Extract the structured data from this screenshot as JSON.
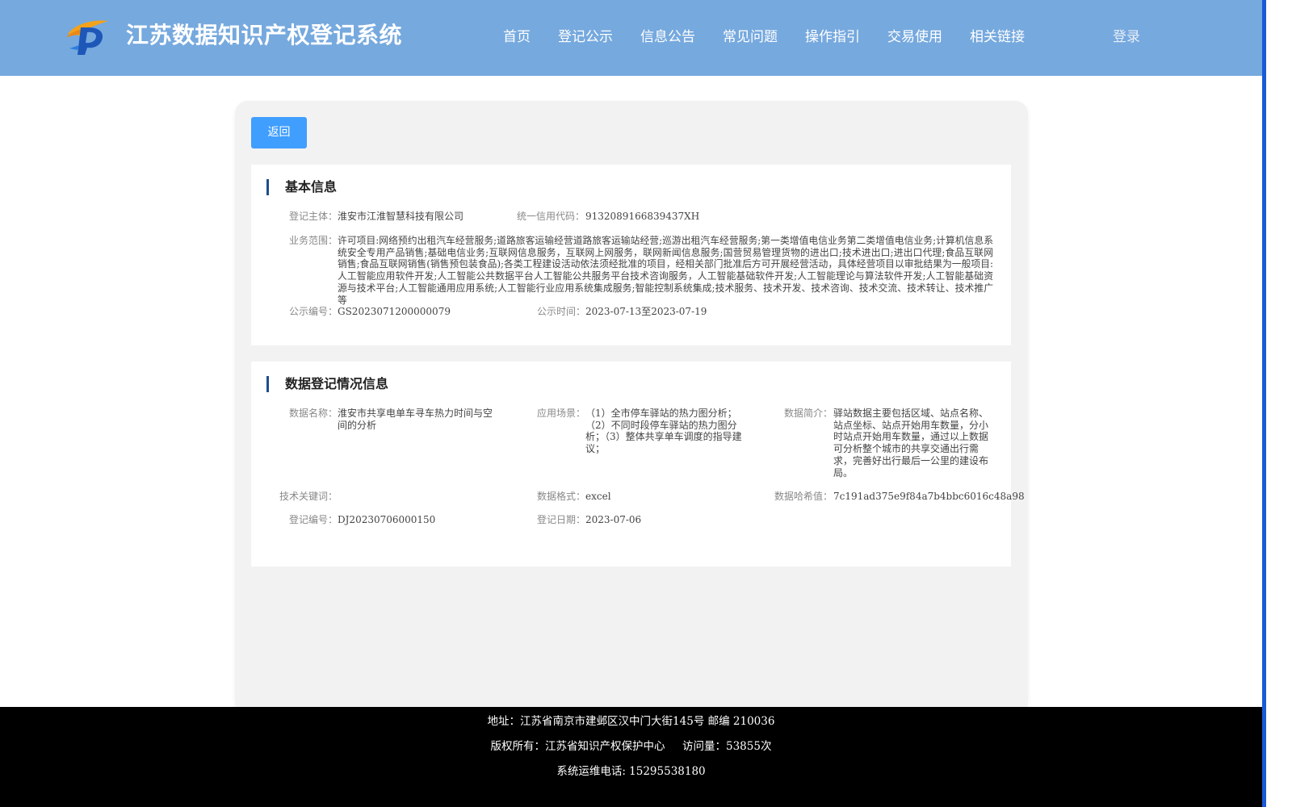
{
  "header": {
    "site_title": "江苏数据知识产权登记系统",
    "nav": [
      "首页",
      "登记公示",
      "信息公告",
      "常见问题",
      "操作指引",
      "交易使用",
      "相关链接"
    ],
    "login": "登录"
  },
  "back_button": "返回",
  "basic_info": {
    "title": "基本信息",
    "registrant_label": "登记主体：",
    "registrant": "淮安市江淮智慧科技有限公司",
    "credit_code_label": "统一信用代码：",
    "credit_code": "9132089166839437XH",
    "business_scope_label": "业务范围：",
    "business_scope": "许可项目:网络预约出租汽车经营服务;道路旅客运输经营道路旅客运输站经营;巡游出租汽车经营服务;第一类增值电信业务第二类增值电信业务;计算机信息系统安全专用产品销售;基础电信业务;互联网信息服务，互联网上网服务，联网新闻信息服务;国营贸易管理货物的进出口;技术进出口;进出口代理;食品互联网销售;食品互联网销售(销售预包装食品);各类工程建设活动依法须经批准的项目，经相关部门批准后方可开展经营活动，具体经营项目以审批结果为一般项目:人工智能应用软件开发;人工智能公共数据平台人工智能公共服务平台技术咨询服务，人工智能基础软件开发;人工智能理论与算法软件开发;人工智能基础资源与技术平台;人工智能通用应用系统;人工智能行业应用系统集成服务;智能控制系统集成;技术服务、技术开发、技术咨询、技术交流、技术转让、技术推广等",
    "publicity_no_label": "公示编号：",
    "publicity_no": "GS2023071200000079",
    "publicity_time_label": "公示时间：",
    "publicity_time": "2023-07-13至2023-07-19"
  },
  "data_info": {
    "title": "数据登记情况信息",
    "data_name_label": "数据名称：",
    "data_name": "淮安市共享电单车寻车热力时间与空间的分析",
    "scenario_label": "应用场景：",
    "scenario": "（1）全市停车驿站的热力图分析；（2）不同时段停车驿站的热力图分析；（3）整体共享单车调度的指导建议；",
    "intro_label": "数据简介：",
    "intro": "驿站数据主要包括区域、站点名称、站点坐标、站点开始用车数量，分小时站点开始用车数量，通过以上数据可分析整个城市的共享交通出行需求，完善好出行最后一公里的建设布局。",
    "keywords_label": "技术关键词：",
    "keywords": "",
    "format_label": "数据格式：",
    "format": "excel",
    "hash_label": "数据哈希值：",
    "hash": "7c191ad375e9f84a7b4bbc6016c48a98",
    "reg_no_label": "登记编号：",
    "reg_no": "DJ20230706000150",
    "reg_date_label": "登记日期：",
    "reg_date": "2023-07-06"
  },
  "footer": {
    "address": "地址：江苏省南京市建邺区汉中门大街145号 邮编 210036",
    "copyright": "版权所有：江苏省知识产权保护中心     访问量：53855次",
    "phone": "系统运维电话: 15295538180"
  }
}
